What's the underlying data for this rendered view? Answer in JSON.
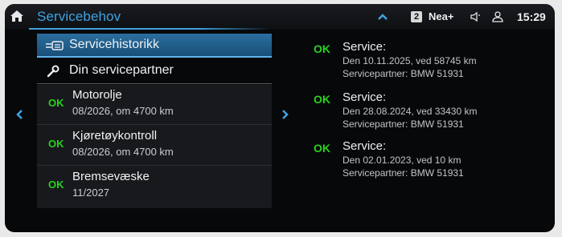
{
  "header": {
    "title": "Servicebehov",
    "status": {
      "badge": "2",
      "network": "Nea+",
      "time": "15:29"
    }
  },
  "menu": {
    "history_label": "Servicehistorikk",
    "partner_label": "Din servicepartner"
  },
  "services": [
    {
      "status": "OK",
      "name": "Motorolje",
      "detail": "08/2026, om 4700 km"
    },
    {
      "status": "OK",
      "name": "Kjøretøykontroll",
      "detail": "08/2026, om 4700 km"
    },
    {
      "status": "OK",
      "name": "Bremsevæske",
      "detail": "11/2027"
    }
  ],
  "history": [
    {
      "status": "OK",
      "title": "Service:",
      "date": "Den 10.11.2025, ved 58745 km",
      "partner": "Servicepartner: BMW 51931"
    },
    {
      "status": "OK",
      "title": "Service:",
      "date": "Den 28.08.2024, ved 33430 km",
      "partner": "Servicepartner: BMW 51931"
    },
    {
      "status": "OK",
      "title": "Service:",
      "date": "Den 02.01.2023, ved 10 km",
      "partner": "Servicepartner: BMW 51931"
    }
  ],
  "colors": {
    "accent": "#3ea3e3",
    "ok": "#2ad21e",
    "background": "#07080a"
  }
}
